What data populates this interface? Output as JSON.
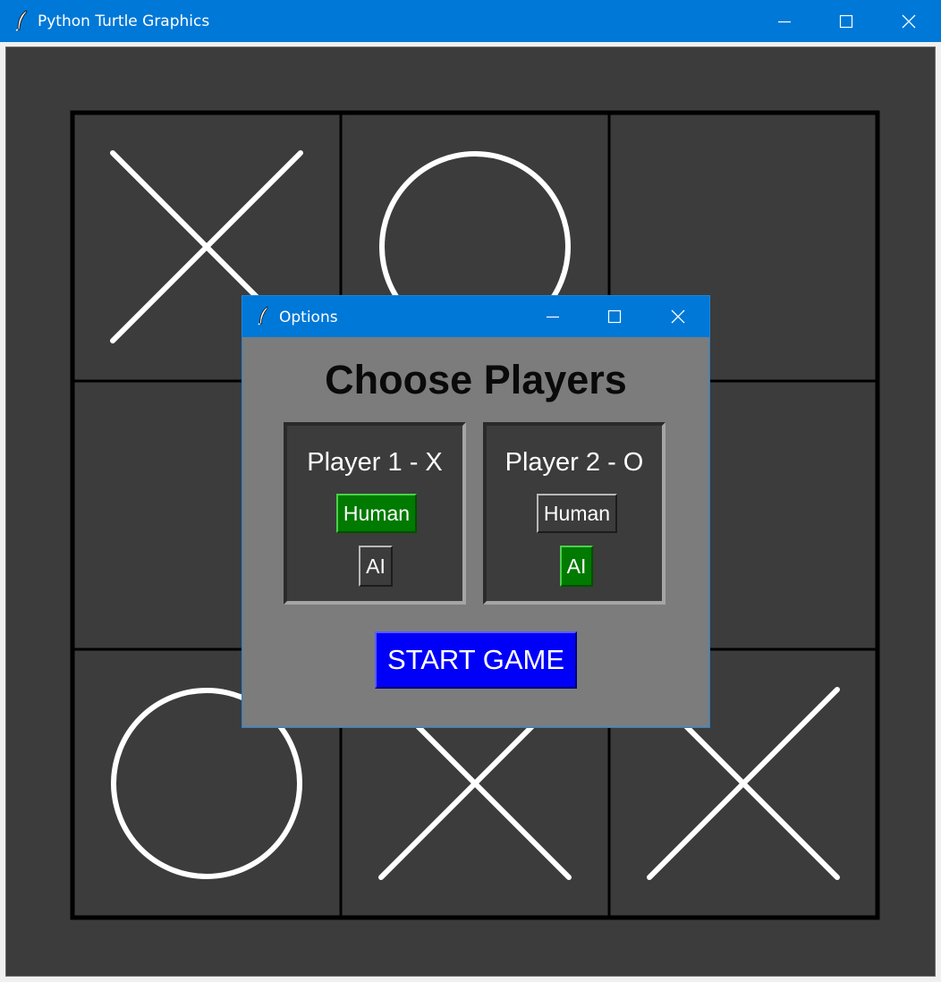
{
  "main_window": {
    "title": "Python Turtle Graphics",
    "icon": "feather-icon",
    "controls": [
      "minimize-icon",
      "maximize-icon",
      "close-icon"
    ]
  },
  "board": {
    "cells": [
      [
        "X",
        "O",
        ""
      ],
      [
        "",
        "",
        ""
      ],
      [
        "O",
        "X",
        "X"
      ]
    ],
    "colors": {
      "background": "#3c3c3c",
      "lines": "#000000",
      "marks": "#ffffff"
    }
  },
  "dialog": {
    "title": "Options",
    "icon": "feather-icon",
    "heading": "Choose Players",
    "players": [
      {
        "label": "Player 1 - X",
        "human_label": "Human",
        "ai_label": "AI",
        "selected": "Human"
      },
      {
        "label": "Player 2 - O",
        "human_label": "Human",
        "ai_label": "AI",
        "selected": "AI"
      }
    ],
    "start_label": "START GAME",
    "colors": {
      "selected": "#007a00",
      "start": "#0000f8",
      "panel": "#3c3c3c",
      "dialog_bg": "#7c7c7c"
    }
  }
}
